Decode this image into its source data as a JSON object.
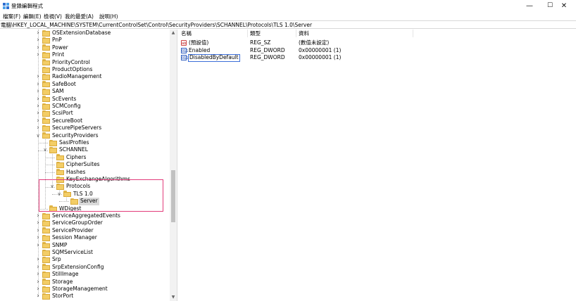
{
  "window": {
    "title": "登錄編輯程式",
    "minimize_glyph": "—",
    "maximize_glyph": "☐",
    "close_glyph": "✕"
  },
  "menu": [
    "檔案(F)",
    "編輯(E)",
    "檢視(V)",
    "我的最愛(A)",
    "說明(H)"
  ],
  "address": "電腦\\HKEY_LOCAL_MACHINE\\SYSTEM\\CurrentControlSet\\Control\\SecurityProviders\\SCHANNEL\\Protocols\\TLS 1.0\\Server",
  "tree": [
    {
      "label": "OSExtensionDatabase",
      "level": 0,
      "chevron": "collapsed"
    },
    {
      "label": "PnP",
      "level": 0,
      "chevron": "collapsed"
    },
    {
      "label": "Power",
      "level": 0,
      "chevron": "collapsed"
    },
    {
      "label": "Print",
      "level": 0,
      "chevron": "collapsed"
    },
    {
      "label": "PriorityControl",
      "level": 0,
      "chevron": "none"
    },
    {
      "label": "ProductOptions",
      "level": 0,
      "chevron": "none"
    },
    {
      "label": "RadioManagement",
      "level": 0,
      "chevron": "collapsed"
    },
    {
      "label": "SafeBoot",
      "level": 0,
      "chevron": "collapsed"
    },
    {
      "label": "SAM",
      "level": 0,
      "chevron": "collapsed"
    },
    {
      "label": "ScEvents",
      "level": 0,
      "chevron": "collapsed"
    },
    {
      "label": "SCMConfig",
      "level": 0,
      "chevron": "collapsed"
    },
    {
      "label": "ScsiPort",
      "level": 0,
      "chevron": "collapsed"
    },
    {
      "label": "SecureBoot",
      "level": 0,
      "chevron": "collapsed"
    },
    {
      "label": "SecurePipeServers",
      "level": 0,
      "chevron": "collapsed"
    },
    {
      "label": "SecurityProviders",
      "level": 0,
      "chevron": "expanded"
    },
    {
      "label": "SaslProfiles",
      "level": 1,
      "chevron": "none"
    },
    {
      "label": "SCHANNEL",
      "level": 1,
      "chevron": "expanded"
    },
    {
      "label": "Ciphers",
      "level": 2,
      "chevron": "none"
    },
    {
      "label": "CipherSuites",
      "level": 2,
      "chevron": "none"
    },
    {
      "label": "Hashes",
      "level": 2,
      "chevron": "none"
    },
    {
      "label": "KeyExchangeAlgorithms",
      "level": 2,
      "chevron": "none"
    },
    {
      "label": "Protocols",
      "level": 2,
      "chevron": "expanded"
    },
    {
      "label": "TLS 1.0",
      "level": 3,
      "chevron": "expanded"
    },
    {
      "label": "Server",
      "level": 4,
      "chevron": "none",
      "selected": true
    },
    {
      "label": "WDigest",
      "level": 1,
      "chevron": "none"
    },
    {
      "label": "ServiceAggregatedEvents",
      "level": 0,
      "chevron": "collapsed"
    },
    {
      "label": "ServiceGroupOrder",
      "level": 0,
      "chevron": "collapsed"
    },
    {
      "label": "ServiceProvider",
      "level": 0,
      "chevron": "collapsed"
    },
    {
      "label": "Session Manager",
      "level": 0,
      "chevron": "collapsed"
    },
    {
      "label": "SNMP",
      "level": 0,
      "chevron": "collapsed"
    },
    {
      "label": "SQMServiceList",
      "level": 0,
      "chevron": "none"
    },
    {
      "label": "Srp",
      "level": 0,
      "chevron": "collapsed"
    },
    {
      "label": "SrpExtensionConfig",
      "level": 0,
      "chevron": "collapsed"
    },
    {
      "label": "StillImage",
      "level": 0,
      "chevron": "collapsed"
    },
    {
      "label": "Storage",
      "level": 0,
      "chevron": "collapsed"
    },
    {
      "label": "StorageManagement",
      "level": 0,
      "chevron": "collapsed"
    },
    {
      "label": "StorPort",
      "level": 0,
      "chevron": "collapsed"
    }
  ],
  "scrollbar": {
    "up_glyph": "▲",
    "down_glyph": "▼",
    "thumb_start": 0.52,
    "thumb_end": 0.72
  },
  "columns": {
    "name": "名稱",
    "type": "類型",
    "data": "資料"
  },
  "values": [
    {
      "icon": "string-value-icon",
      "icon_text": "ab",
      "name": "(預設值)",
      "type": "REG_SZ",
      "data": "(數值未設定)"
    },
    {
      "icon": "dword-value-icon",
      "icon_text": "011",
      "name": "Enabled",
      "type": "REG_DWORD",
      "data": "0x00000001 (1)"
    },
    {
      "icon": "dword-value-icon",
      "icon_text": "011",
      "name": "DisabledByDefault",
      "type": "REG_DWORD",
      "data": "0x00000001 (1)",
      "editing": true
    }
  ],
  "colors": {
    "highlight": "#e23c7a",
    "folder": "#f3cd66",
    "selection": "#d9d9d9"
  }
}
